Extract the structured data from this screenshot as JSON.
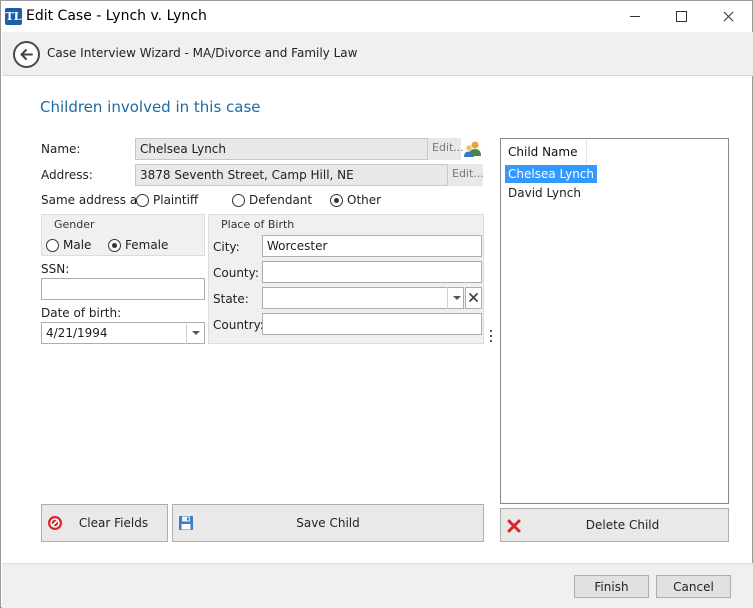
{
  "window": {
    "title": "Edit Case - Lynch v. Lynch",
    "app_icon_text": "TL"
  },
  "wizard": {
    "title": "Case Interview Wizard - MA/Divorce and Family Law"
  },
  "section_title": "Children involved in this case",
  "form": {
    "name_label": "Name:",
    "name_value": "Chelsea Lynch",
    "name_edit": "Edit...",
    "address_label": "Address:",
    "address_value": "3878 Seventh Street, Camp Hill, NE",
    "address_edit": "Edit...",
    "same_address_label": "Same address as:",
    "same_address_options": [
      "Plaintiff",
      "Defendant",
      "Other"
    ],
    "same_address_selected": "Other",
    "gender_title": "Gender",
    "gender_options": [
      "Male",
      "Female"
    ],
    "gender_selected": "Female",
    "ssn_label": "SSN:",
    "ssn_value": "",
    "dob_label": "Date of birth:",
    "dob_value": "4/21/1994",
    "birth_title": "Place of Birth",
    "city_label": "City:",
    "city_value": "Worcester",
    "county_label": "County:",
    "county_value": "",
    "state_label": "State:",
    "state_value": "",
    "country_label": "Country:",
    "country_value": ""
  },
  "child_list": {
    "header": "Child Name",
    "items": [
      "Chelsea Lynch",
      "David Lynch"
    ],
    "selected_index": 0
  },
  "buttons": {
    "clear_fields": "Clear Fields",
    "save_child": "Save Child",
    "delete_child": "Delete Child",
    "finish": "Finish",
    "cancel": "Cancel"
  },
  "colors": {
    "accent": "#1c6aa5",
    "selection": "#3399ff",
    "delete_red": "#d9262b"
  },
  "icons": {
    "app": "app-logo-icon",
    "back": "back-arrow-icon",
    "contact": "contact-picker-icon",
    "clear": "clear-icon",
    "save": "save-disk-icon",
    "delete": "delete-x-icon"
  }
}
